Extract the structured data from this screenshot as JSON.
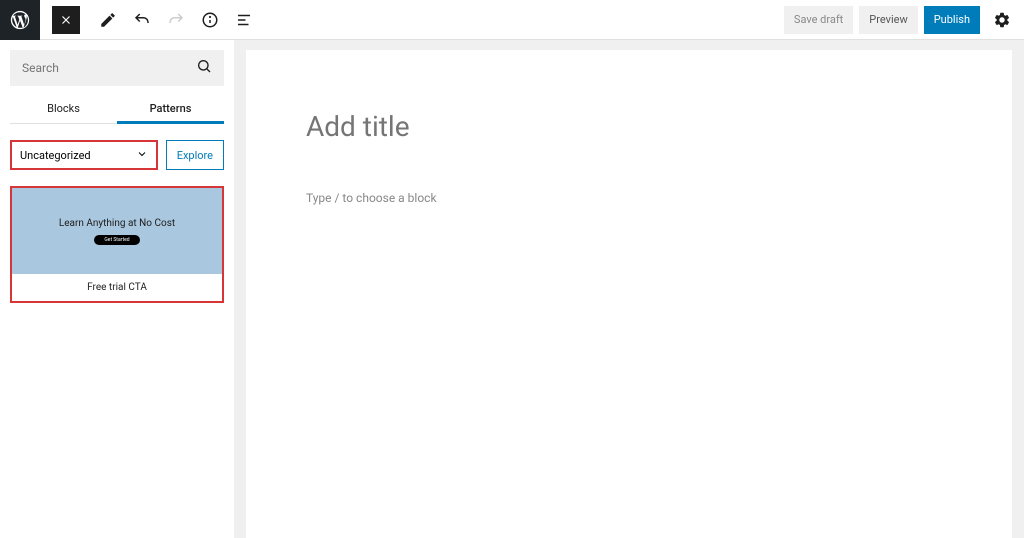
{
  "topbar": {
    "save_draft_label": "Save draft",
    "preview_label": "Preview",
    "publish_label": "Publish"
  },
  "sidebar": {
    "search_placeholder": "Search",
    "tabs": {
      "blocks": "Blocks",
      "patterns": "Patterns"
    },
    "category_selected": "Uncategorized",
    "explore_label": "Explore",
    "pattern": {
      "preview_title": "Learn Anything at No Cost",
      "preview_button": "Get Started",
      "label": "Free trial CTA"
    }
  },
  "editor": {
    "title_placeholder": "Add title",
    "block_placeholder": "Type / to choose a block"
  }
}
